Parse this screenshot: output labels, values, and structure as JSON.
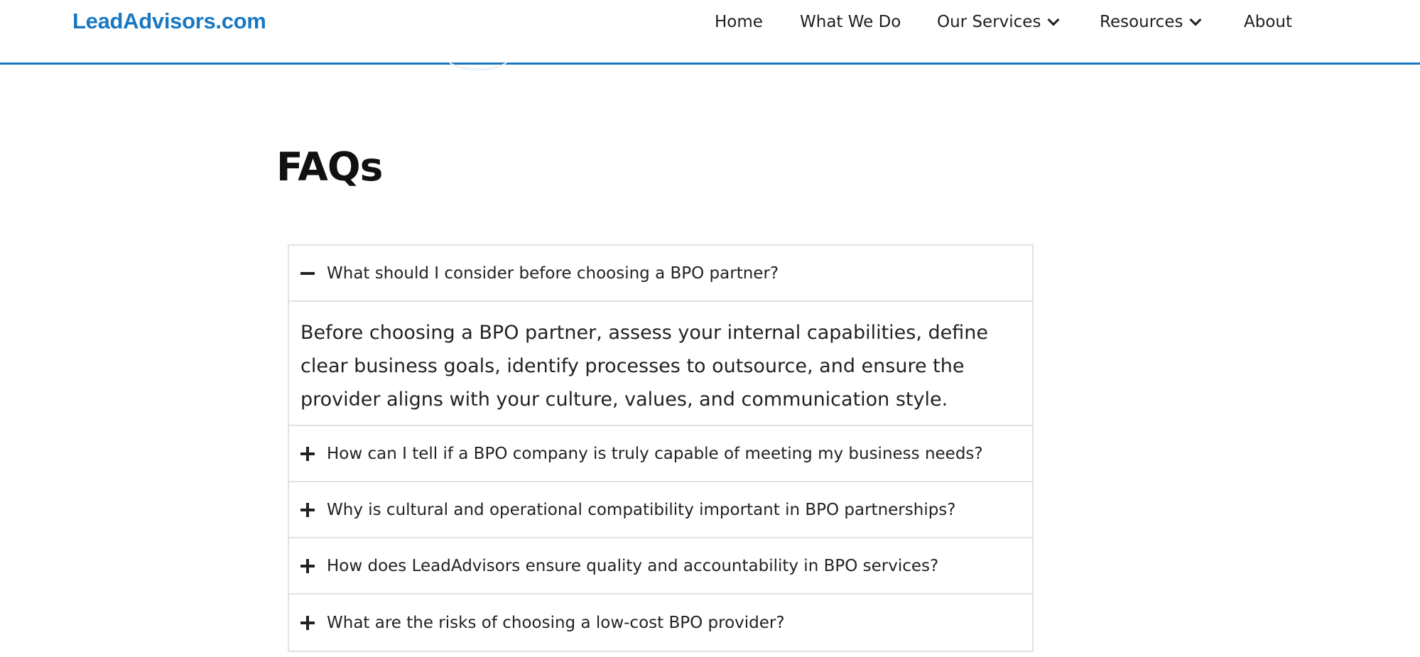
{
  "header": {
    "logo": "LeadAdvisors.com",
    "nav": [
      {
        "label": "Home",
        "has_dropdown": false
      },
      {
        "label": "What We Do",
        "has_dropdown": false
      },
      {
        "label": "Our Services",
        "has_dropdown": true
      },
      {
        "label": "Resources",
        "has_dropdown": true
      },
      {
        "label": "About",
        "has_dropdown": false
      }
    ],
    "accent_color": "#1a78c2"
  },
  "faq": {
    "title": "FAQs",
    "items": [
      {
        "question": "What should I consider before choosing a BPO partner?",
        "expanded": true,
        "icon": "minus-icon",
        "answer": "Before choosing a BPO partner, assess your internal capabilities, define clear business goals, identify processes to outsource, and ensure the provider aligns with your culture, values, and communication style."
      },
      {
        "question": "How can I tell if a BPO company is truly capable of meeting my business needs?",
        "expanded": false,
        "icon": "plus-icon"
      },
      {
        "question": "Why is cultural and operational compatibility important in BPO partnerships?",
        "expanded": false,
        "icon": "plus-icon"
      },
      {
        "question": "How does LeadAdvisors ensure quality and accountability in BPO services?",
        "expanded": false,
        "icon": "plus-icon"
      },
      {
        "question": "What are the risks of choosing a low-cost BPO provider?",
        "expanded": false,
        "icon": "plus-icon"
      }
    ]
  }
}
